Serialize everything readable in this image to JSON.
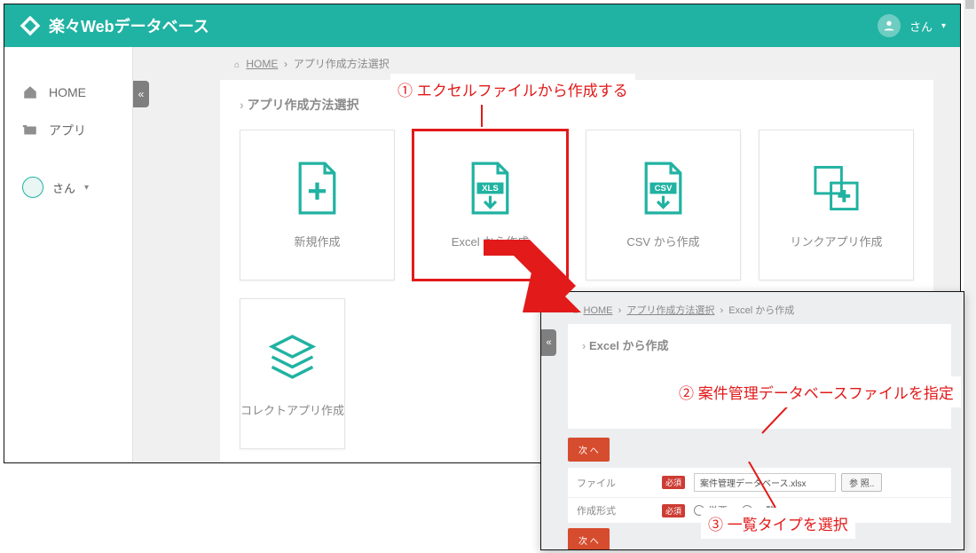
{
  "header": {
    "brand": "楽々Webデータベース",
    "user_suffix": "さん"
  },
  "sidebar": {
    "home": "HOME",
    "apps": "アプリ",
    "user_suffix": "さん"
  },
  "breadcrumbs1": {
    "home": "HOME",
    "sep": "›",
    "page": "アプリ作成方法選択"
  },
  "panel1": {
    "title": "アプリ作成方法選択",
    "cards": {
      "new": "新規作成",
      "excel": "Excel から作成",
      "csv": "CSV から作成",
      "link": "リンクアプリ作成",
      "collect": "コレクトアプリ作成"
    }
  },
  "annotations": {
    "a1": "エクセルファイルから作成する",
    "a2": "案件管理データベースファイルを指定",
    "a3": "一覧タイプを選択",
    "n1": "①",
    "n2": "②",
    "n3": "③"
  },
  "breadcrumbs2": {
    "home": "HOME",
    "page1": "アプリ作成方法選択",
    "page2": "Excel から作成"
  },
  "panel2": {
    "title": "Excel から作成",
    "next": "次 へ",
    "file_label": "ファイル",
    "required": "必須",
    "file_value": "案件管理データベース.xlsx",
    "browse": "参 照..",
    "format_label": "作成形式",
    "radio_single": "単票",
    "radio_list": "一覧"
  }
}
